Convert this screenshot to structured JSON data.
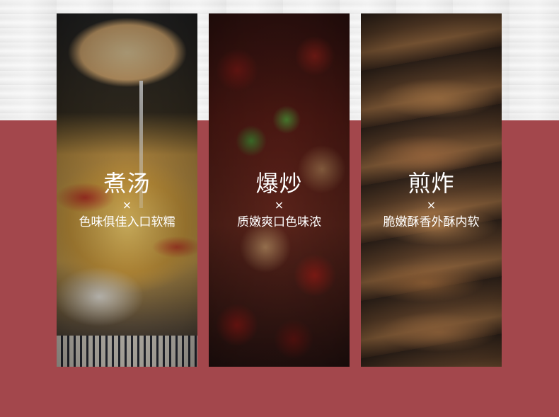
{
  "cards": [
    {
      "title": "煮汤",
      "mark": "×",
      "desc": "色味俱佳入口软糯"
    },
    {
      "title": "爆炒",
      "mark": "×",
      "desc": "质嫩爽口色味浓"
    },
    {
      "title": "煎炸",
      "mark": "×",
      "desc": "脆嫩酥香外酥内软"
    }
  ],
  "colors": {
    "background": "#a3474c",
    "top_background": "#efefef"
  }
}
